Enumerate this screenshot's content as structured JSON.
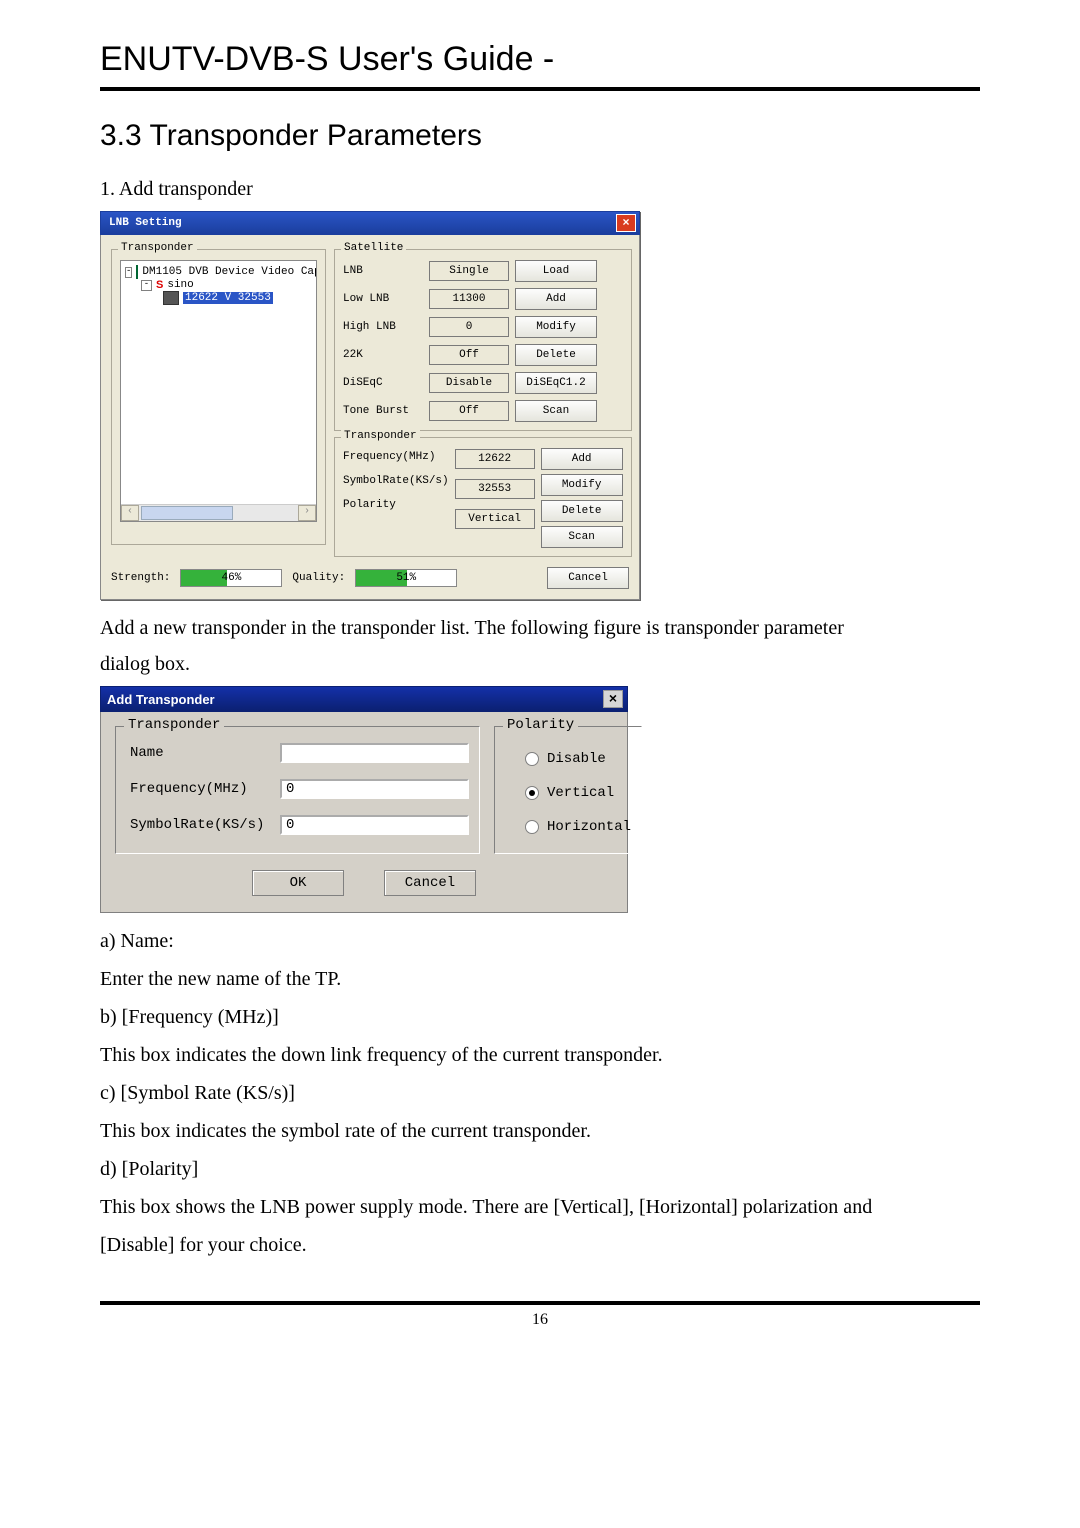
{
  "header": {
    "title": "ENUTV-DVB-S  User's  Guide  -"
  },
  "section": {
    "heading": "3.3 Transponder Parameters",
    "step1": "1. Add transponder",
    "after_dlg1_a": "Add a new transponder in the transponder list. The following figure is transponder parameter",
    "after_dlg1_b": "dialog box.",
    "a_label": "a) Name:",
    "a_text": "Enter the new name of the TP.",
    "b_label": "b) [Frequency (MHz)]",
    "b_text": "This box indicates the down link frequency of the current transponder.",
    "c_label": "c) [Symbol Rate (KS/s)]",
    "c_text": "This box indicates the symbol rate of the current transponder.",
    "d_label": "d) [Polarity]",
    "d_text1": "This box shows the LNB power supply mode. There are [Vertical], [Horizontal] polarization and",
    "d_text2": "[Disable] for your choice."
  },
  "dlg1": {
    "title": "LNB Setting",
    "close": "×",
    "transponder_legend": "Transponder",
    "tree": {
      "root": "DM1105 DVB Device Video Cap",
      "sat_letter": "S",
      "sat_name": "sino",
      "tp": "12622 V 32553"
    },
    "satellite_legend": "Satellite",
    "sat_rows": [
      {
        "label": "LNB",
        "value": "Single",
        "btn": "Load"
      },
      {
        "label": "Low LNB",
        "value": "11300",
        "btn": "Add"
      },
      {
        "label": "High LNB",
        "value": "0",
        "btn": "Modify"
      },
      {
        "label": "22K",
        "value": "Off",
        "btn": "Delete"
      },
      {
        "label": "DiSEqC",
        "value": "Disable",
        "btn": "DiSEqC1.2"
      },
      {
        "label": "Tone Burst",
        "value": "Off",
        "btn": "Scan"
      }
    ],
    "tp_legend": "Transponder",
    "tp_rows": {
      "freq_label": "Frequency(MHz)",
      "freq_value": "12622",
      "sr_label": "SymbolRate(KS/s)",
      "sr_value": "32553",
      "pol_label": "Polarity",
      "pol_value": "Vertical"
    },
    "tp_btns": [
      "Add",
      "Modify",
      "Delete",
      "Scan"
    ],
    "strength_label": "Strength:",
    "strength_pct": "46%",
    "quality_label": "Quality:",
    "quality_pct": "51%",
    "cancel": "Cancel"
  },
  "dlg2": {
    "title": "Add Transponder",
    "close": "×",
    "transponder_legend": "Transponder",
    "polarity_legend": "Polarity",
    "name_label": "Name",
    "freq_label": "Frequency(MHz)",
    "freq_value": "0",
    "sr_label": "SymbolRate(KS/s)",
    "sr_value": "0",
    "polarity_options": {
      "disable": "Disable",
      "vertical": "Vertical",
      "horizontal": "Horizontal",
      "selected": "vertical"
    },
    "ok": "OK",
    "cancel": "Cancel"
  },
  "footer": {
    "page": "16"
  }
}
